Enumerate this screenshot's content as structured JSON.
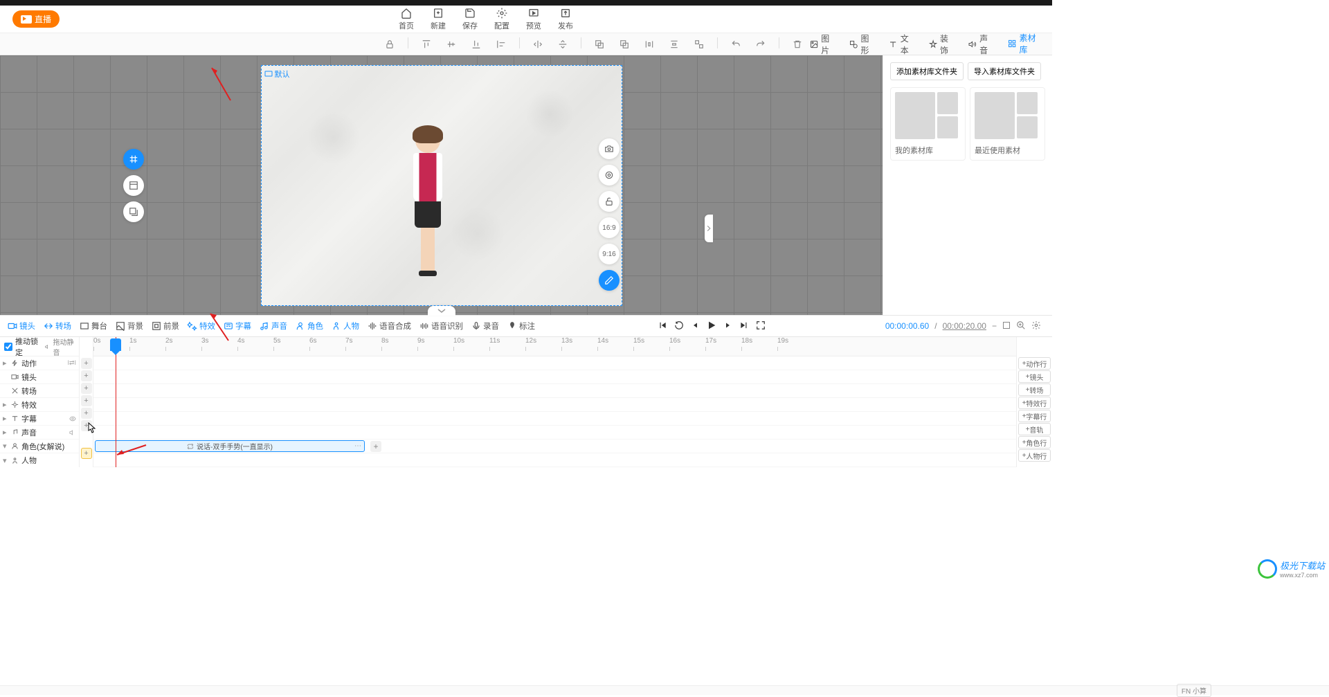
{
  "header": {
    "live_label": "直播",
    "nav": [
      {
        "icon": "home-icon",
        "label": "首页"
      },
      {
        "icon": "new-icon",
        "label": "新建"
      },
      {
        "icon": "save-icon",
        "label": "保存"
      },
      {
        "icon": "config-icon",
        "label": "配置"
      },
      {
        "icon": "preview-icon",
        "label": "预览"
      },
      {
        "icon": "publish-icon",
        "label": "发布"
      }
    ]
  },
  "asset_tabs": [
    {
      "icon": "image-icon",
      "label": "图片"
    },
    {
      "icon": "shape-icon",
      "label": "图形"
    },
    {
      "icon": "text-icon",
      "label": "文本"
    },
    {
      "icon": "decor-icon",
      "label": "装饰"
    },
    {
      "icon": "sound-icon",
      "label": "声音"
    },
    {
      "icon": "library-icon",
      "label": "素材库",
      "active": true
    }
  ],
  "right_panel": {
    "add_folder": "添加素材库文件夹",
    "import_folder": "导入素材库文件夹",
    "cards": [
      {
        "label": "我的素材库"
      },
      {
        "label": "最近使用素材"
      }
    ]
  },
  "canvas": {
    "default_label": "默认",
    "ratio1": "16:9",
    "ratio2": "9:16"
  },
  "timeline_tabs": [
    {
      "icon": "camera-icon",
      "label": "镜头",
      "blue": true
    },
    {
      "icon": "transition-icon",
      "label": "转场",
      "blue": true
    },
    {
      "icon": "stage-icon",
      "label": "舞台"
    },
    {
      "icon": "bg-icon",
      "label": "背景"
    },
    {
      "icon": "fg-icon",
      "label": "前景"
    },
    {
      "icon": "effect-icon",
      "label": "特效",
      "blue": true
    },
    {
      "icon": "subtitle-icon",
      "label": "字幕",
      "blue": true
    },
    {
      "icon": "sound-icon",
      "label": "声音",
      "blue": true
    },
    {
      "icon": "role-icon",
      "label": "角色",
      "blue": true
    },
    {
      "icon": "person-icon",
      "label": "人物",
      "blue": true
    },
    {
      "icon": "tts-icon",
      "label": "语音合成"
    },
    {
      "icon": "asr-icon",
      "label": "语音识别"
    },
    {
      "icon": "record-icon",
      "label": "录音"
    },
    {
      "icon": "label-icon",
      "label": "标注"
    }
  ],
  "time": {
    "current": "00:00:00.60",
    "total": "00:00:20.00"
  },
  "track_header": {
    "lock": "推动锁定",
    "mute": "拖动静音"
  },
  "tracks": [
    {
      "icon": "action-icon",
      "label": "动作"
    },
    {
      "icon": "camera-icon",
      "label": "镜头"
    },
    {
      "icon": "transition-icon",
      "label": "转场"
    },
    {
      "icon": "effect-icon",
      "label": "特效"
    },
    {
      "icon": "subtitle-icon",
      "label": "字幕"
    },
    {
      "icon": "sound-icon",
      "label": "声音"
    },
    {
      "icon": "role-icon",
      "label": "角色(女解说)"
    },
    {
      "icon": "person-icon",
      "label": "人物"
    }
  ],
  "right_tracks": [
    {
      "label": "动作行"
    },
    {
      "label": "镜头"
    },
    {
      "label": "转场"
    },
    {
      "label": "特效行"
    },
    {
      "label": "字幕行"
    },
    {
      "label": "音轨"
    },
    {
      "label": "角色行"
    },
    {
      "label": "人物行"
    }
  ],
  "ruler": [
    "0s",
    "1s",
    "2s",
    "3s",
    "4s",
    "5s",
    "6s",
    "7s",
    "8s",
    "9s",
    "10s",
    "11s",
    "12s",
    "13s",
    "14s",
    "15s",
    "16s",
    "17s",
    "18s",
    "19s"
  ],
  "clip_label": "说话-双手手势(一直显示)",
  "bottom_label": "FN 小算"
}
